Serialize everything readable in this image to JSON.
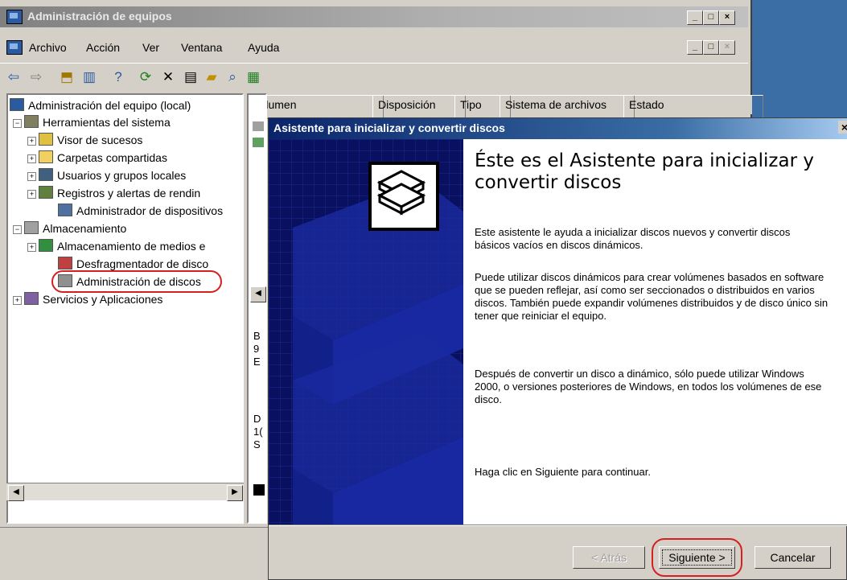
{
  "main_window": {
    "title": "Administración de equipos",
    "controls": [
      "_",
      "□",
      "×"
    ],
    "mdi_controls": [
      "_",
      "□",
      "×"
    ],
    "menus": [
      "Archivo",
      "Acción",
      "Ver",
      "Ventana",
      "Ayuda"
    ]
  },
  "toolbar": {
    "icons": [
      "back-icon",
      "forward-icon",
      "up-folder-icon",
      "show-hide-tree-icon",
      "help-icon",
      "refresh-icon",
      "delete-icon",
      "properties-icon",
      "open-icon",
      "search-icon",
      "export-icon"
    ]
  },
  "tree": {
    "root": "Administración del equipo (local)",
    "groups": [
      {
        "label": "Herramientas del sistema",
        "children": [
          "Visor de sucesos",
          "Carpetas compartidas",
          "Usuarios y grupos locales",
          "Registros y alertas de rendin",
          "Administrador de dispositivos"
        ]
      },
      {
        "label": "Almacenamiento",
        "children": [
          "Almacenamiento de medios e",
          "Desfragmentador de disco",
          "Administración de discos"
        ]
      },
      {
        "label": "Servicios y Aplicaciones",
        "children": []
      }
    ],
    "highlighted": "Administración de discos"
  },
  "columns": [
    "Volumen",
    "Disposición",
    "Tipo",
    "Sistema de archivos",
    "Estado"
  ],
  "partial_text": [
    "B",
    "9",
    "E",
    "D",
    "1(",
    "S"
  ],
  "dialog": {
    "title": "Asistente para inicializar y convertir discos",
    "close": "×",
    "heading": "Éste es el Asistente para inicializar y convertir discos",
    "paragraphs": [
      "Este asistente le ayuda a inicializar discos nuevos y convertir discos básicos vacíos en discos dinámicos.",
      "Puede utilizar discos dinámicos para crear volúmenes basados en software que se pueden reflejar, así como ser seccionados o distribuidos en varios discos. También puede expandir volúmenes distribuidos y de disco único sin tener que reiniciar el equipo.",
      "Después de convertir un disco a dinámico, sólo puede utilizar Windows 2000, o versiones posteriores de Windows, en todos los volúmenes de ese disco.",
      "Haga clic en Siguiente para continuar."
    ],
    "buttons": {
      "back": "< Atrás",
      "next": "Siguiente >",
      "cancel": "Cancelar"
    }
  },
  "colors": {
    "dialog_title": "#0a246a",
    "side_panel": "#0a1060",
    "highlight": "#d42020"
  }
}
